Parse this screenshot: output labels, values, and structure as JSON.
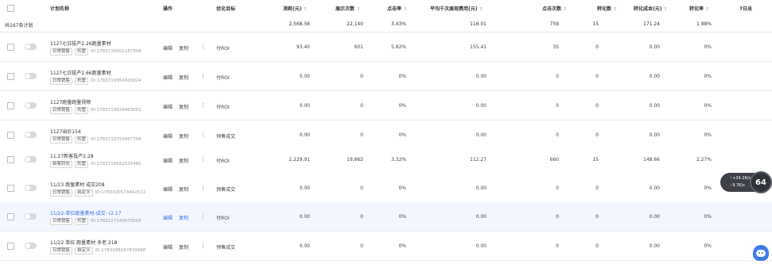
{
  "header": {
    "plan_name": "计划名称",
    "operation": "操作",
    "goal": "优化目标",
    "cost": "消耗(元)",
    "impressions": "展示次数",
    "ctr": "点击率",
    "cpm": "平均千次展现费用(元)",
    "clicks": "点击次数",
    "conversions": "转化数",
    "cpa": "转化成本(元)",
    "cvr": "转化率",
    "seven_day": "7日总",
    "sort_glyph": "⇕"
  },
  "summary": {
    "label": "共167条计划",
    "cost": "2,568.56",
    "impressions": "22,140",
    "ctr": "3.43%",
    "cpm": "116.01",
    "clicks": "759",
    "conversions": "15",
    "cpa": "171.24",
    "cvr": "1.98%"
  },
  "ops": {
    "edit": "编辑",
    "copy": "复制",
    "more": "⋮"
  },
  "rows": [
    {
      "name": "1127七日投产2.26跑量素材",
      "tags": [
        "日常销售",
        "托管"
      ],
      "id": "ID:1783720001187908",
      "goal": "付ROI",
      "cost": "93.40",
      "impressions": "601",
      "ctr": "5.82%",
      "cpm": "155.41",
      "clicks": "35",
      "conversions": "0",
      "cpa": "0.00",
      "cvr": "0%"
    },
    {
      "name": "1127七日投产2.66跑量素材",
      "tags": [
        "日常销售",
        "托管"
      ],
      "id": "ID:1783719954935824",
      "goal": "付ROI",
      "cost": "0.00",
      "impressions": "0",
      "ctr": "0%",
      "cpm": "0.00",
      "clicks": "0",
      "conversions": "0",
      "cpa": "0.00",
      "cvr": "0%"
    },
    {
      "name": "1127跑量跑量视频",
      "tags": [
        "日常销售",
        "托管"
      ],
      "id": "ID:1783719829463051",
      "goal": "付ROI",
      "cost": "0.00",
      "impressions": "0",
      "ctr": "0%",
      "cpm": "0.00",
      "clicks": "0",
      "conversions": "0",
      "cpa": "0.00",
      "cvr": "0%"
    },
    {
      "name": "1127出价154",
      "tags": [
        "日常销售",
        "托管"
      ],
      "id": "ID:1783719753967706",
      "goal": "预售成交",
      "cost": "0.00",
      "impressions": "0",
      "ctr": "0%",
      "cpm": "0.00",
      "clicks": "0",
      "conversions": "0",
      "cpa": "0.00",
      "cvr": "0%"
    },
    {
      "name": "11.27新客投产2.28",
      "tags": [
        "新客转化",
        "托管"
      ],
      "id": "ID:1783719582525481",
      "goal": "付ROI",
      "cost": "2,229.91",
      "impressions": "19,862",
      "ctr": "3.32%",
      "cpm": "112.27",
      "clicks": "660",
      "conversions": "15",
      "cpa": "148.66",
      "cvr": "2.27%"
    },
    {
      "name": "11/23 跑量素材 成交208",
      "tags": [
        "日常销售",
        "自定义"
      ],
      "id": "ID:1783320574442522",
      "goal": "预售成交",
      "cost": "0.00",
      "impressions": "0",
      "ctr": "0%",
      "cpm": "0.00",
      "clicks": "0",
      "conversions": "0",
      "cpa": "0.00",
      "cvr": "0%"
    },
    {
      "name": "11/22-单拉跑量素材-成交- r2.17",
      "tags": [
        "日常销售",
        "托管"
      ],
      "id": "ID:1783227140670505",
      "goal": "付ROI",
      "cost": "0.00",
      "impressions": "0",
      "ctr": "0%",
      "cpm": "0.00",
      "clicks": "0",
      "conversions": "0",
      "cpa": "0.00",
      "cvr": "0%"
    },
    {
      "name": "11/22 单拉 跑量素材 多老 218",
      "tags": [
        "日常销售",
        "自定义"
      ],
      "id": "ID:1783188267839498",
      "goal": "预售成交",
      "cost": "0.00",
      "impressions": "0",
      "ctr": "0%",
      "cpm": "0.00",
      "clicks": "0",
      "conversions": "0",
      "cpa": "0.00",
      "cvr": "0%"
    }
  ],
  "widget": {
    "up": "+34.2",
    "up_unit": "K/s",
    "down": "9.7",
    "down_unit": "K/s",
    "value": "64"
  }
}
